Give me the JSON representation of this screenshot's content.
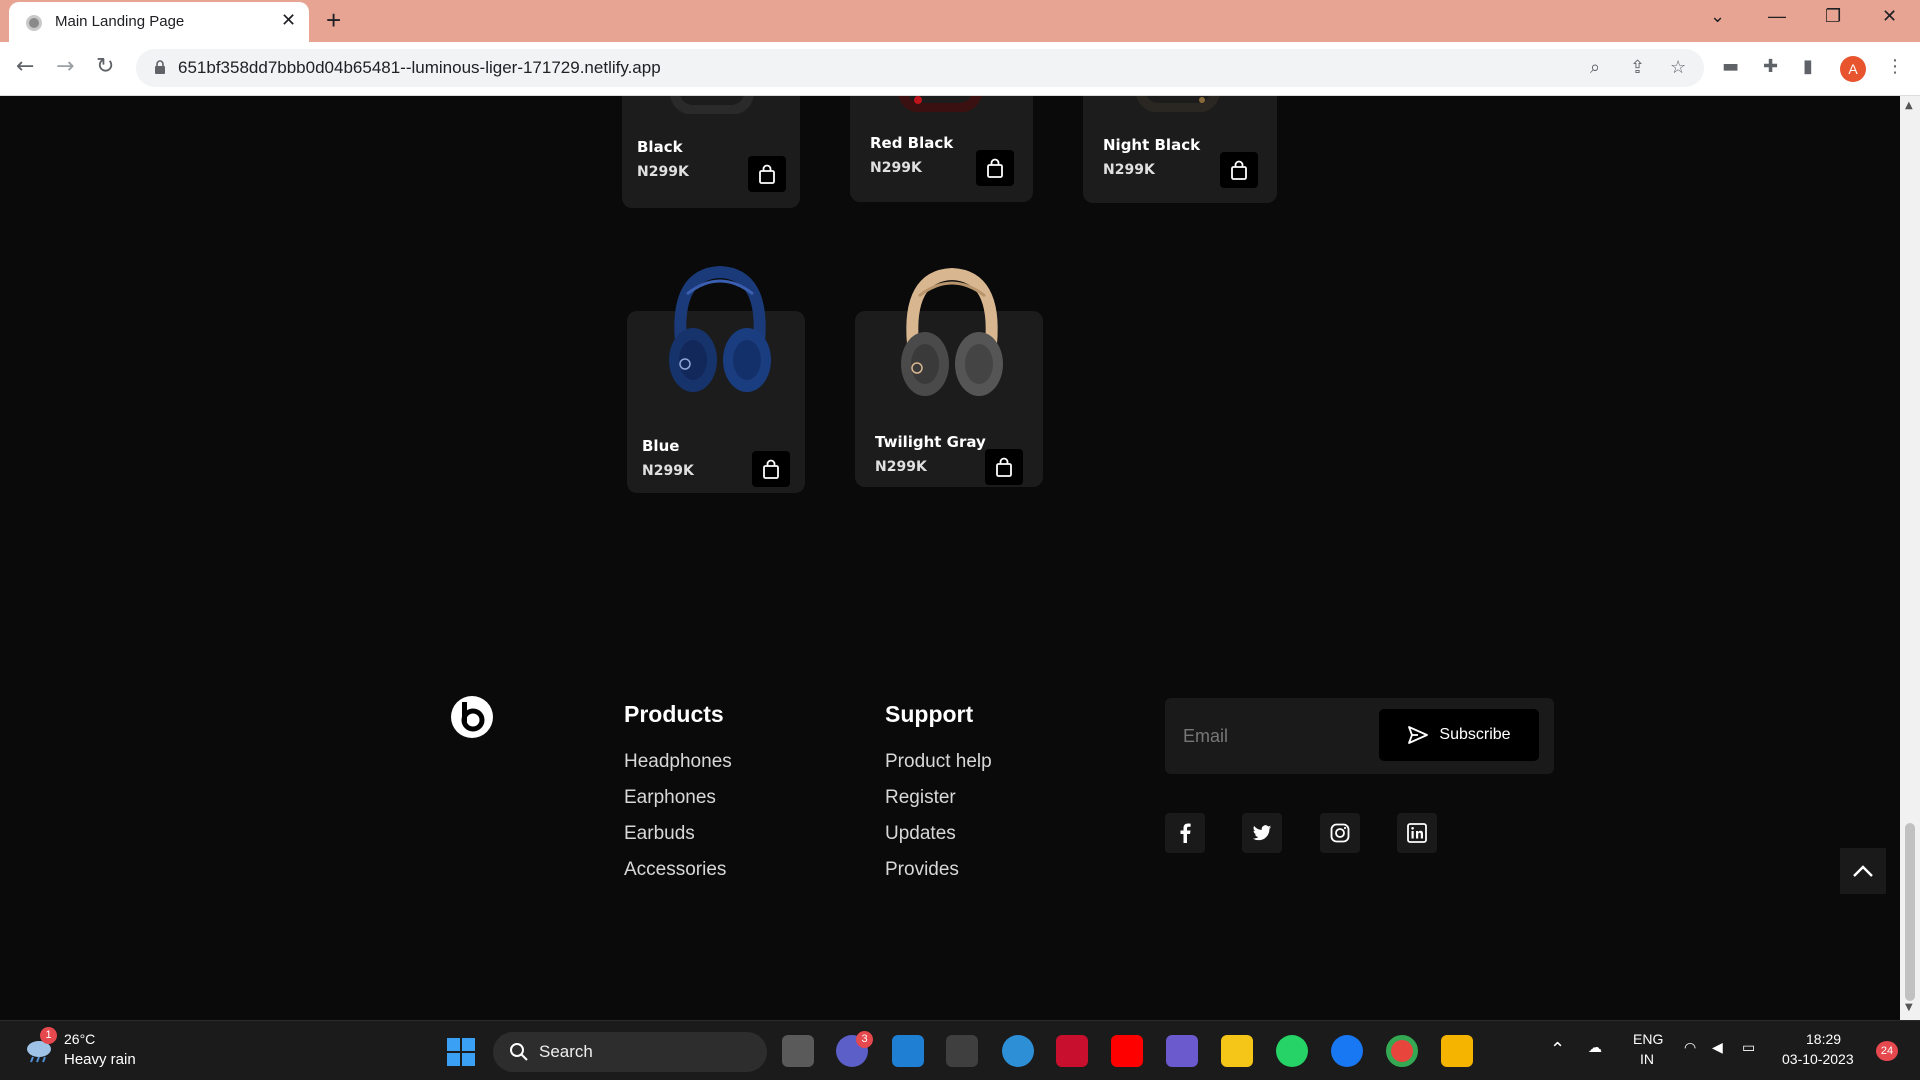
{
  "browser": {
    "tab_title": "Main Landing Page",
    "url": "651bf358dd7bbb0d04b65481--luminous-liger-171729.netlify.app",
    "profile_initial": "A"
  },
  "products": [
    {
      "name": "Black",
      "price": "N299K"
    },
    {
      "name": "Red Black",
      "price": "N299K"
    },
    {
      "name": "Night Black",
      "price": "N299K"
    },
    {
      "name": "Blue",
      "price": "N299K"
    },
    {
      "name": "Twilight Gray",
      "price": "N299K"
    }
  ],
  "footer": {
    "products_title": "Products",
    "products_links": [
      "Headphones",
      "Earphones",
      "Earbuds",
      "Accessories"
    ],
    "support_title": "Support",
    "support_links": [
      "Product help",
      "Register",
      "Updates",
      "Provides"
    ],
    "email_placeholder": "Email",
    "subscribe_label": "Subscribe"
  },
  "taskbar": {
    "weather_temp": "26°C",
    "weather_desc": "Heavy rain",
    "weather_badge": "1",
    "search_label": "Search",
    "teams_badge": "3",
    "lang_top": "ENG",
    "lang_bottom": "IN",
    "time": "18:29",
    "date": "03-10-2023",
    "notif_count": "24"
  },
  "colors": {
    "page_bg": "#0a0a0a",
    "card_bg": "#1c1c1c",
    "tab_bar": "#e8a493"
  }
}
